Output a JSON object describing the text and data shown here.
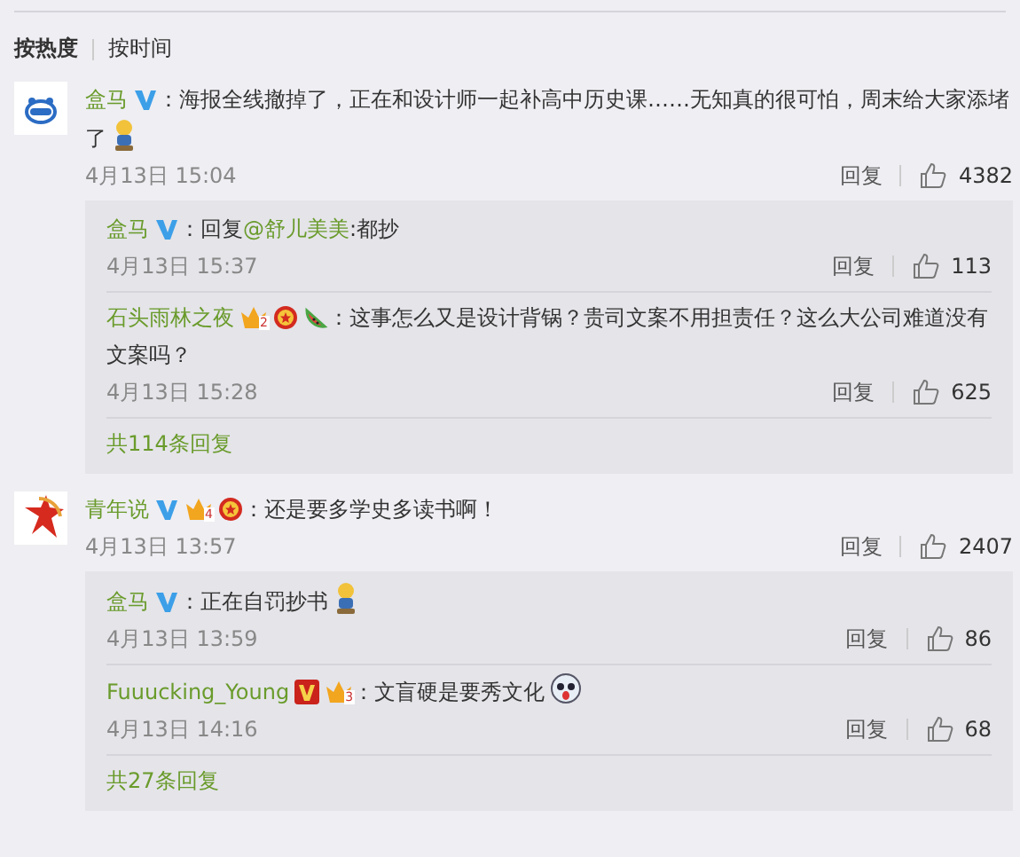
{
  "sort_tabs": [
    {
      "label": "按热度",
      "selected": true
    },
    {
      "label": "按时间",
      "selected": false
    }
  ],
  "comments": [
    {
      "avatar": {
        "kind": "hippo"
      },
      "user": "盒马",
      "badges": [
        {
          "kind": "verified-blue"
        }
      ],
      "segments": [
        {
          "kind": "plain",
          "text": "：海报全线撤掉了，正在和设计师一起补高中历史课……无知真的很可怕，周末给大家添堵了"
        }
      ],
      "trailing_icon": {
        "kind": "figure"
      },
      "time": "4月13日 15:04",
      "reply_label": "回复",
      "likes": "4382",
      "replies": [
        {
          "user": "盒马",
          "badges": [
            {
              "kind": "verified-blue"
            }
          ],
          "segments": [
            {
              "kind": "plain",
              "text": "：回复"
            },
            {
              "kind": "mention",
              "text": "@舒儿美美"
            },
            {
              "kind": "plain",
              "text": ":都抄"
            }
          ],
          "time": "4月13日 15:37",
          "reply_label": "回复",
          "likes": "113"
        },
        {
          "user": "石头雨林之夜",
          "badges": [
            {
              "kind": "vip",
              "label": "2"
            },
            {
              "kind": "medal"
            },
            {
              "kind": "melon"
            }
          ],
          "segments": [
            {
              "kind": "plain",
              "text": "：这事怎么又是设计背锅？贵司文案不用担责任？这么大公司难道没有文案吗？"
            }
          ],
          "time": "4月13日 15:28",
          "reply_label": "回复",
          "likes": "625"
        }
      ],
      "more": "共114条回复"
    },
    {
      "avatar": {
        "kind": "star"
      },
      "user": "青年说",
      "badges": [
        {
          "kind": "verified-blue"
        },
        {
          "kind": "vip",
          "label": "4"
        },
        {
          "kind": "medal"
        }
      ],
      "segments": [
        {
          "kind": "plain",
          "text": "：还是要多学史多读书啊！"
        }
      ],
      "time": "4月13日 13:57",
      "reply_label": "回复",
      "likes": "2407",
      "replies": [
        {
          "user": "盒马",
          "badges": [
            {
              "kind": "verified-blue"
            }
          ],
          "segments": [
            {
              "kind": "plain",
              "text": "：正在自罚抄书"
            }
          ],
          "trailing_icon": {
            "kind": "figure"
          },
          "time": "4月13日 13:59",
          "reply_label": "回复",
          "likes": "86"
        },
        {
          "user": "Fuuucking_Young",
          "badges": [
            {
              "kind": "verified-red"
            },
            {
              "kind": "vip",
              "label": "3"
            }
          ],
          "segments": [
            {
              "kind": "plain",
              "text": "：文盲硬是要秀文化"
            }
          ],
          "trailing_icon": {
            "kind": "face"
          },
          "time": "4月13日 14:16",
          "reply_label": "回复",
          "likes": "68"
        }
      ],
      "more": "共27条回复"
    }
  ]
}
